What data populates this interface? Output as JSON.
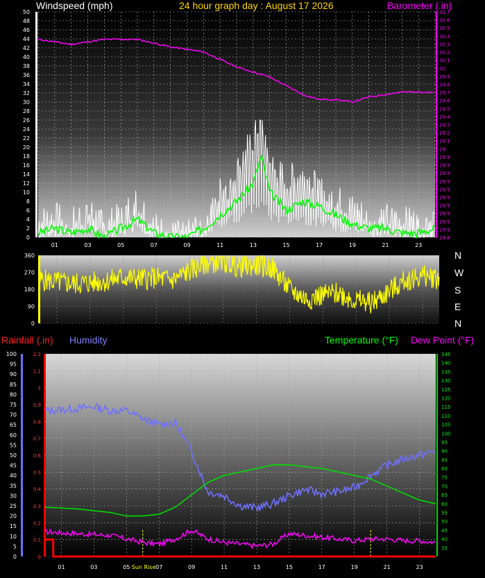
{
  "header": {
    "windspeed_label": "Windspeed (mph)",
    "title": "24 hour graph day : August 17 2026",
    "barometer_label": "Barometer (.in)"
  },
  "compass": [
    "N",
    "W",
    "S",
    "E",
    "N"
  ],
  "bottom_header": {
    "rainfall_label": "Rainfall (.in)",
    "humidity_label": "Humidity",
    "temperature_label": "Temperature (°F)",
    "dewpoint_label": "Dew Point (°F)"
  },
  "annotations": {
    "sunrise": "Sun Rise"
  },
  "colors": {
    "windspeed": "#ffffff",
    "windspeed_avg": "#00ff00",
    "barometer": "#ff00ff",
    "winddir": "#ffff00",
    "humidity": "#7070ff",
    "temperature": "#00dd00",
    "dewpoint": "#ff00ff",
    "rainfall": "#ff0000"
  },
  "chart_data": [
    {
      "type": "line",
      "name": "wind-barometer",
      "x_ticks": [
        "01",
        "03",
        "05",
        "07",
        "09",
        "11",
        "13",
        "15",
        "17",
        "19",
        "21",
        "23"
      ],
      "y_left": {
        "label": "Windspeed (mph)",
        "lim": [
          0,
          50
        ],
        "ticks": [
          "0",
          "2",
          "4",
          "6",
          "8",
          "10",
          "12",
          "14",
          "16",
          "18",
          "20",
          "22",
          "24",
          "26",
          "28",
          "30",
          "32",
          "34",
          "36",
          "38",
          "40",
          "42",
          "44",
          "46",
          "48",
          "50"
        ]
      },
      "y_right": {
        "label": "Barometer (.in)",
        "lim": [
          29.8,
          30.7
        ],
        "ticks": [
          "29.8",
          "29.9",
          "29.9",
          "29.9",
          "29.9",
          "29.9",
          "29.9",
          "29.9",
          "29.9",
          "29.9",
          "29.9",
          "29",
          "29.1",
          "29.2",
          "29.3",
          "29.4",
          "29.5",
          "29.6",
          "29.7",
          "29.8",
          "29.9",
          "30",
          "30.1",
          "30.2",
          "30.3",
          "30.4",
          "30.5",
          "30.6",
          "30.7"
        ]
      },
      "barometer": {
        "x": [
          0,
          2,
          4,
          6,
          8,
          10,
          12,
          14,
          16,
          17,
          18,
          19,
          20,
          22,
          24
        ],
        "y": [
          30.59,
          30.57,
          30.59,
          30.59,
          30.56,
          30.54,
          30.48,
          30.44,
          30.37,
          30.35,
          30.35,
          30.34,
          30.36,
          30.38,
          30.38
        ]
      },
      "gust": {
        "x": [
          0,
          1,
          2,
          3,
          4,
          5,
          6,
          7,
          8,
          9,
          10,
          11,
          12,
          12.5,
          13,
          13.5,
          14,
          15,
          16,
          17,
          18,
          19,
          20,
          21,
          22,
          23,
          24
        ],
        "y": [
          3,
          4,
          3,
          6,
          2,
          4,
          8,
          2,
          0,
          0,
          3,
          10,
          14,
          18,
          22,
          26,
          16,
          12,
          14,
          10,
          8,
          6,
          4,
          4,
          3,
          3,
          4
        ]
      },
      "average": {
        "x": [
          0,
          1,
          2,
          3,
          4,
          5,
          6,
          7,
          8,
          9,
          10,
          11,
          12,
          12.5,
          13,
          13.5,
          14,
          15,
          16,
          17,
          18,
          19,
          20,
          21,
          22,
          23,
          24
        ],
        "y": [
          1,
          2,
          1,
          2,
          0,
          2,
          4,
          1,
          0,
          0,
          2,
          5,
          8,
          10,
          12,
          18,
          10,
          6,
          8,
          7,
          5,
          3,
          2,
          2,
          1,
          1,
          2
        ]
      }
    },
    {
      "type": "line",
      "name": "wind-direction",
      "y_ticks": [
        "0",
        "90",
        "180",
        "270",
        "360"
      ],
      "ylim": [
        0,
        360
      ],
      "direction": {
        "x": [
          0,
          1,
          2,
          3,
          4,
          5,
          6,
          7,
          8,
          9,
          10,
          11,
          12,
          13,
          14,
          15,
          16,
          17,
          18,
          19,
          20,
          21,
          22,
          23,
          24
        ],
        "y": [
          230,
          220,
          210,
          215,
          225,
          245,
          235,
          240,
          230,
          280,
          320,
          330,
          300,
          310,
          290,
          180,
          130,
          150,
          160,
          120,
          110,
          170,
          230,
          250,
          240
        ]
      }
    },
    {
      "type": "line",
      "name": "rain-humidity-temp",
      "y_left_rain": {
        "label": "Rainfall (.in)",
        "lim": [
          0,
          1.2
        ],
        "ticks": [
          "0",
          "0.1",
          "0.2",
          "0.3",
          "0.4",
          "0.5",
          "0.6",
          "0.7",
          "0.8",
          "0.9",
          "1",
          "1.1",
          "1.2"
        ]
      },
      "y_left_humidity": {
        "label": "Humidity",
        "lim": [
          0,
          100
        ],
        "ticks": [
          "0",
          "5",
          "10",
          "15",
          "20",
          "25",
          "30",
          "35",
          "40",
          "45",
          "50",
          "55",
          "60",
          "65",
          "70",
          "75",
          "80",
          "85",
          "90",
          "95",
          "100"
        ]
      },
      "y_right_temp": {
        "label": "Temperature (°F)",
        "lim": [
          30,
          145
        ],
        "ticks": [
          "35",
          "40",
          "45",
          "50",
          "55",
          "60",
          "65",
          "70",
          "75",
          "80",
          "85",
          "90",
          "95",
          "100",
          "105",
          "110",
          "115",
          "120",
          "125",
          "130",
          "135",
          "140",
          "145"
        ]
      },
      "humidity": {
        "x": [
          0,
          2,
          3,
          4,
          5,
          6,
          7,
          8,
          9,
          10,
          11,
          12,
          13,
          14,
          15,
          16,
          17,
          18,
          19,
          20,
          21,
          22,
          23,
          24
        ],
        "y": [
          72,
          73,
          74,
          72,
          72,
          68,
          65,
          66,
          52,
          32,
          30,
          25,
          24,
          26,
          30,
          33,
          31,
          32,
          34,
          40,
          45,
          48,
          50,
          52
        ]
      },
      "temperature": {
        "x": [
          0,
          2,
          4,
          5,
          6,
          7,
          8,
          9,
          10,
          11,
          12,
          13,
          14,
          15,
          16,
          17,
          18,
          19,
          20,
          21,
          22,
          23,
          24
        ],
        "y": [
          58,
          57,
          55,
          53,
          53,
          54,
          58,
          65,
          72,
          76,
          78,
          80,
          82,
          82,
          81,
          80,
          78,
          76,
          74,
          70,
          66,
          62,
          60
        ]
      },
      "dewpoint": {
        "x": [
          0,
          2,
          4,
          5,
          6,
          7,
          8,
          9,
          10,
          11,
          12,
          13,
          14,
          15,
          16,
          17,
          18,
          19,
          20,
          21,
          22,
          23,
          24
        ],
        "y": [
          44,
          43,
          42,
          40,
          38,
          37,
          40,
          45,
          40,
          38,
          37,
          36,
          37,
          43,
          42,
          41,
          40,
          39,
          40,
          40,
          39,
          39,
          38
        ]
      },
      "rainfall": {
        "x": [
          0,
          0.5,
          0.5,
          24
        ],
        "y": [
          0.1,
          0.1,
          0,
          0
        ]
      },
      "sunrise_hour": 6.0
    }
  ]
}
